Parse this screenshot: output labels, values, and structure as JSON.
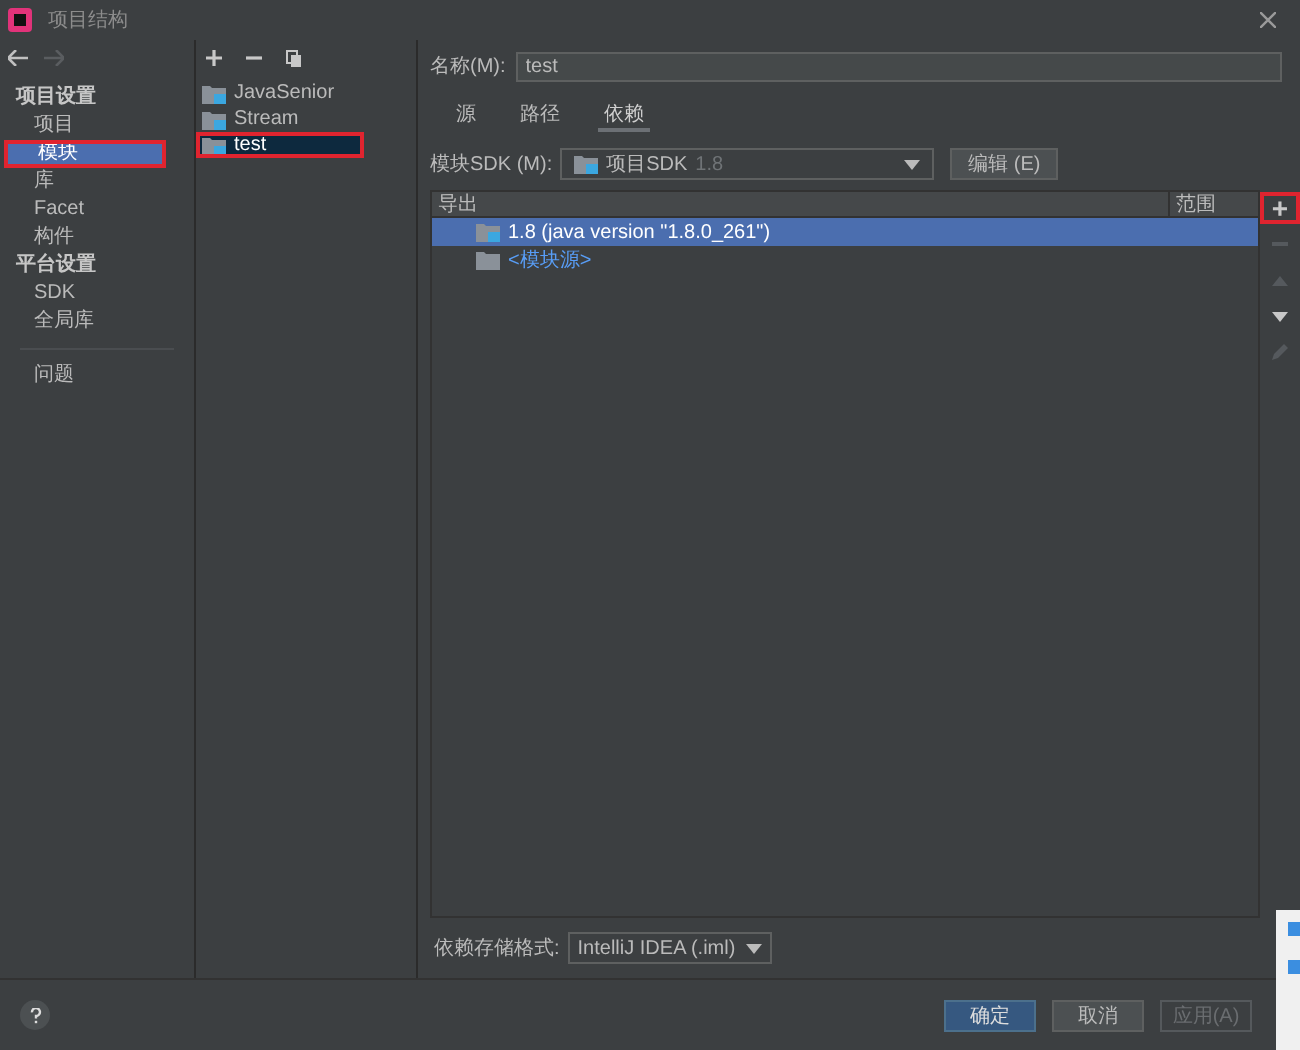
{
  "window": {
    "title": "项目结构"
  },
  "nav": [
    {
      "kind": "header",
      "label": "项目设置",
      "selected": false,
      "annotated": false
    },
    {
      "kind": "item",
      "label": "项目",
      "selected": false,
      "annotated": false
    },
    {
      "kind": "item",
      "label": "模块",
      "selected": true,
      "annotated": true
    },
    {
      "kind": "item",
      "label": "库",
      "selected": false,
      "annotated": false
    },
    {
      "kind": "item",
      "label": "Facet",
      "selected": false,
      "annotated": false
    },
    {
      "kind": "item",
      "label": "构件",
      "selected": false,
      "annotated": false
    },
    {
      "kind": "header",
      "label": "平台设置",
      "selected": false,
      "annotated": false
    },
    {
      "kind": "item",
      "label": "SDK",
      "selected": false,
      "annotated": false
    },
    {
      "kind": "item",
      "label": "全局库",
      "selected": false,
      "annotated": false
    },
    {
      "kind": "separator"
    },
    {
      "kind": "item",
      "label": "问题",
      "selected": false,
      "annotated": false
    }
  ],
  "modules": [
    {
      "label": "JavaSenior",
      "selected": false,
      "annotated": false
    },
    {
      "label": "Stream",
      "selected": false,
      "annotated": false
    },
    {
      "label": "test",
      "selected": true,
      "annotated": true
    }
  ],
  "name_field": {
    "label": "名称(M):",
    "value": "test"
  },
  "tabs": [
    {
      "label": "源",
      "selected": false
    },
    {
      "label": "路径",
      "selected": false
    },
    {
      "label": "依赖",
      "selected": true
    }
  ],
  "sdk": {
    "label": "模块SDK (M):",
    "value": "项目SDK",
    "hint": "1.8",
    "edit_button": "编辑 (E)"
  },
  "table": {
    "columns": [
      "导出",
      "范围"
    ],
    "rows": [
      {
        "kind": "sdk",
        "label": "1.8 (java version \"1.8.0_261\")",
        "selected": true
      },
      {
        "kind": "source",
        "label": "<模块源>",
        "selected": false
      }
    ]
  },
  "side_tools": [
    {
      "kind": "add",
      "label": "+",
      "annotated": true,
      "disabled": false
    },
    {
      "kind": "remove",
      "annotated": false,
      "disabled": true
    },
    {
      "kind": "up",
      "annotated": false,
      "disabled": true
    },
    {
      "kind": "down",
      "annotated": false,
      "disabled": false
    },
    {
      "kind": "edit",
      "annotated": false,
      "disabled": true
    }
  ],
  "storage": {
    "label": "依赖存储格式:",
    "value": "IntelliJ IDEA (.iml)"
  },
  "buttons": [
    {
      "label": "确定",
      "kind": "primary",
      "disabled": false
    },
    {
      "label": "取消",
      "kind": "normal",
      "disabled": false
    },
    {
      "label": "应用(A)",
      "kind": "normal",
      "disabled": true
    }
  ]
}
